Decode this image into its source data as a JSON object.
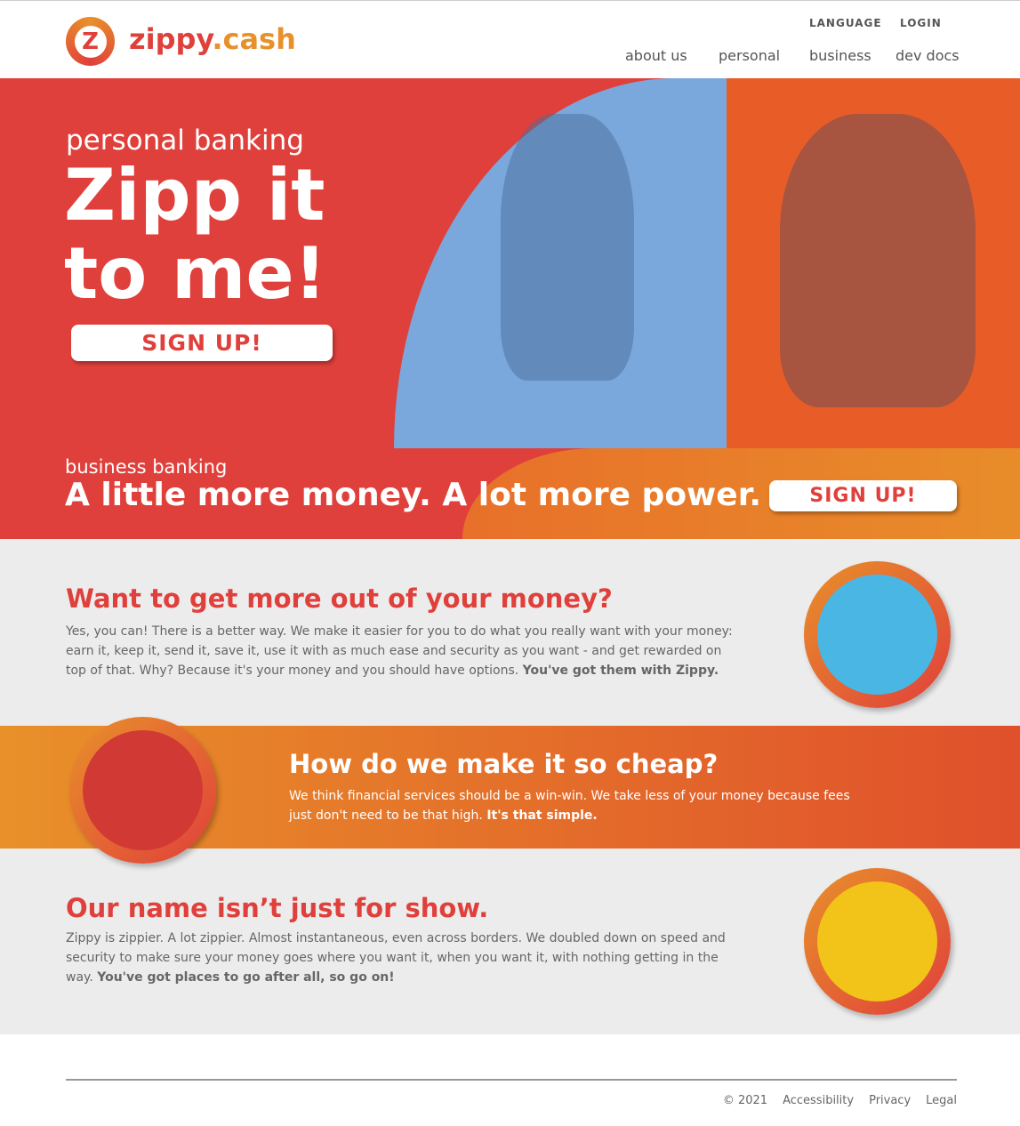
{
  "brand": {
    "logo_letter": "Z",
    "name_part1": "zippy",
    "name_part2": ".cash"
  },
  "nav": {
    "top": [
      "LANGUAGE",
      "LOGIN"
    ],
    "main": [
      "about us",
      "personal",
      "business",
      "dev docs"
    ]
  },
  "hero": {
    "eyebrow": "personal banking",
    "title_line1": "Zipp it",
    "title_line2": "to me!",
    "signup": "SIGN UP!"
  },
  "business": {
    "eyebrow": "business banking",
    "title": "A little more money. A lot more power.",
    "signup": "SIGN UP!"
  },
  "sections": [
    {
      "title": "Want to get more out of your money?",
      "body": "Yes, you can! There is a better way. We make it easier for you to do what you really want with your money: earn it, keep it, send it, save it, use it with as much ease and security as you want - and get rewarded on top of that. Why? Because it's your money and you should have options. ",
      "bold": "You've got them with Zippy."
    },
    {
      "title": "How do we make it so cheap?",
      "body": "We think financial services should be a win-win. We take less of your money because fees just don't need to be that high. ",
      "bold": "It's that simple."
    },
    {
      "title": "Our name isn’t just for show.",
      "body": "Zippy is zippier. A lot zippier. Almost instantaneous, even across borders. We doubled down on speed and security to make sure your money goes where you want it, when you want it, with nothing getting in the way. ",
      "bold": "You've got places to go after all, so go on!"
    }
  ],
  "footer": {
    "links": [
      "© 2021",
      "Accessibility",
      "Privacy",
      "Legal"
    ]
  },
  "colors": {
    "red": "#e0403b",
    "orange": "#e8902a",
    "blue": "#7aa8dc"
  }
}
